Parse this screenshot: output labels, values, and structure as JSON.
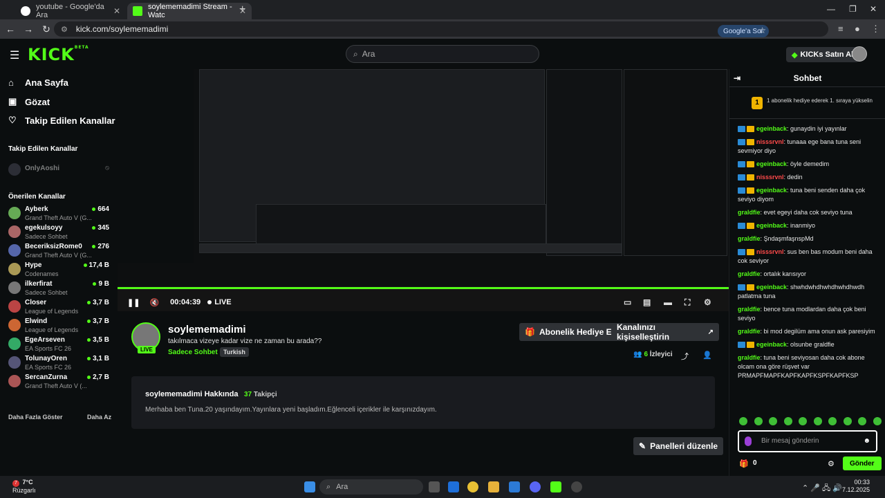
{
  "browser": {
    "tabs": [
      {
        "title": "youtube - Google'da Ara",
        "active": false
      },
      {
        "title": "soylememadimi Stream - Watc",
        "active": true
      }
    ],
    "url": "kick.com/soylememadimi",
    "google_sor": "Google'a Sor"
  },
  "header": {
    "logo": "KICK",
    "logo_beta": "BETA",
    "search_placeholder": "Ara",
    "kicks_button": "KICKs Satın Al"
  },
  "sidebar": {
    "nav": [
      {
        "label": "Ana Sayfa",
        "icon": "home-icon"
      },
      {
        "label": "Gözat",
        "icon": "browse-icon"
      },
      {
        "label": "Takip Edilen Kanallar",
        "icon": "heart-icon"
      }
    ],
    "followed_title": "Takip Edilen Kanallar",
    "followed": [
      {
        "name": "OnlyAoshi"
      }
    ],
    "recommended_title": "Önerilen Kanallar",
    "recommended": [
      {
        "name": "Ayberk",
        "category": "Grand Theft Auto V (G...",
        "viewers": "664"
      },
      {
        "name": "egekulsoyy",
        "category": "Sadece Sohbet",
        "viewers": "345"
      },
      {
        "name": "BeceriksizRome0",
        "category": "Grand Theft Auto V (G...",
        "viewers": "276"
      },
      {
        "name": "Hype",
        "category": "Codenames",
        "viewers": "17,4 B"
      },
      {
        "name": "ilkerfirat",
        "category": "Sadece Sohbet",
        "viewers": "9 B"
      },
      {
        "name": "Closer",
        "category": "League of Legends",
        "viewers": "3,7 B"
      },
      {
        "name": "Elwind",
        "category": "League of Legends",
        "viewers": "3,7 B"
      },
      {
        "name": "EgeArseven",
        "category": "EA Sports FC 26",
        "viewers": "3,5 B"
      },
      {
        "name": "TolunayOren",
        "category": "EA Sports FC 26",
        "viewers": "3,1 B"
      },
      {
        "name": "SercanZurna",
        "category": "Grand Theft Auto V (...",
        "viewers": "2,7 B"
      }
    ],
    "show_more": "Daha Fazla Göster",
    "show_less": "Daha Az"
  },
  "player": {
    "time": "00:04:39",
    "live": "LIVE"
  },
  "stream": {
    "name": "soylememadimi",
    "title": "takılmaca vizeye kadar vize ne zaman bu arada??",
    "category": "Sadece Sohbet",
    "tag": "Turkish",
    "live_badge": "LIVE",
    "gift_button": "Abonelik Hediye Et",
    "customize_button": "Kanalınızı kişiselleştirin",
    "viewers": "6",
    "viewers_label": "İzleyici"
  },
  "about": {
    "title": "soylememadimi Hakkında",
    "followers": "37",
    "followers_label": "Takipçi",
    "text": "Merhaba ben Tuna.20 yaşındayım.Yayınlara yeni başladım.Eğlenceli içerikler ile karşınızdayım."
  },
  "edit_panels": "Panelleri düzenle",
  "chat": {
    "title": "Sohbet",
    "pinned_count": "1",
    "pinned_text": "1 abonelik hediye ederek 1. sıraya yükselin",
    "messages": [
      {
        "user": "egeinback",
        "color": "#53fc18",
        "badges": true,
        "text": "gunaydin iyi yayınlar"
      },
      {
        "user": "nisssrvnl",
        "color": "#ff4a4a",
        "badges": true,
        "text": "tunaaa ege bana tuna seni sevmiyor diyo"
      },
      {
        "user": "egeinback",
        "color": "#53fc18",
        "badges": true,
        "text": "öyle demedim"
      },
      {
        "user": "nisssrvnl",
        "color": "#ff4a4a",
        "badges": true,
        "text": "dedin"
      },
      {
        "user": "egeinback",
        "color": "#53fc18",
        "badges": true,
        "text": "tuna beni senden daha çok seviyo diyom"
      },
      {
        "user": "graldfie",
        "color": "#53fc18",
        "badges": false,
        "text": "evet egeyi daha cok seviyo tuna"
      },
      {
        "user": "egeinback",
        "color": "#53fc18",
        "badges": true,
        "text": "inanmiyo"
      },
      {
        "user": "graldfie",
        "color": "#53fc18",
        "badges": false,
        "text": "ŞndaşmfaşnspMd"
      },
      {
        "user": "nisssrvnl",
        "color": "#ff4a4a",
        "badges": true,
        "text": "sus ben bas modum beni daha cok seviyor"
      },
      {
        "user": "graldfie",
        "color": "#53fc18",
        "badges": false,
        "text": "ortalık karısıyor"
      },
      {
        "user": "egeinback",
        "color": "#53fc18",
        "badges": true,
        "text": "shwhdwhdhwhdhwhdhwdh patlatma tuna"
      },
      {
        "user": "graldfie",
        "color": "#53fc18",
        "badges": false,
        "text": "bence tuna modlardan daha çok beni seviyo"
      },
      {
        "user": "graldfie",
        "color": "#53fc18",
        "badges": false,
        "text": "bi mod degilüm ama onun ask paresiyim"
      },
      {
        "user": "egeinback",
        "color": "#53fc18",
        "badges": true,
        "text": "olsunbe graldfie"
      },
      {
        "user": "graldfie",
        "color": "#53fc18",
        "badges": false,
        "text": "tuna beni seviyosan daha cok abone olcam ona göre rüşvet var PRMAPFMAPFKAPFKAPFKSPFKAPFKSP"
      }
    ],
    "input_placeholder": "Bir mesaj gönderin",
    "gift_count": "0",
    "send_button": "Gönder"
  },
  "taskbar": {
    "temperature": "7°C",
    "weather": "Rüzgarlı",
    "weather_badge": "7",
    "search": "Ara",
    "time": "00:33",
    "date": "7.12.2025"
  }
}
